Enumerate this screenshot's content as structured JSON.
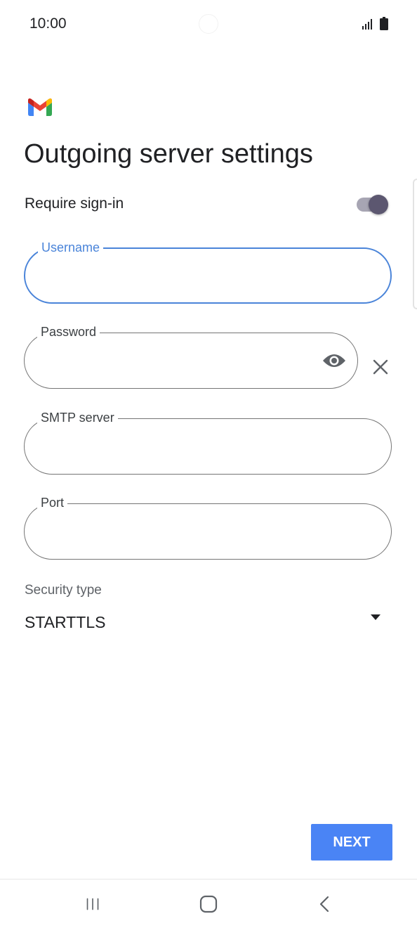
{
  "status_bar": {
    "time": "10:00"
  },
  "app": {
    "logo_icon": "gmail-icon"
  },
  "page": {
    "title": "Outgoing server settings"
  },
  "require_signin": {
    "label": "Require sign-in",
    "enabled": true
  },
  "fields": {
    "username": {
      "label": "Username",
      "value": ""
    },
    "password": {
      "label": "Password",
      "value": ""
    },
    "smtp_server": {
      "label": "SMTP server",
      "value": ""
    },
    "port": {
      "label": "Port",
      "value": ""
    }
  },
  "security": {
    "label": "Security type",
    "value": "STARTTLS"
  },
  "actions": {
    "next_label": "NEXT"
  },
  "nav": {
    "icons": [
      "recents-icon",
      "home-icon",
      "back-icon"
    ]
  },
  "colors": {
    "accent": "#4a84f5",
    "focus": "#4a84d9",
    "toggle_thumb": "#5c5770"
  }
}
